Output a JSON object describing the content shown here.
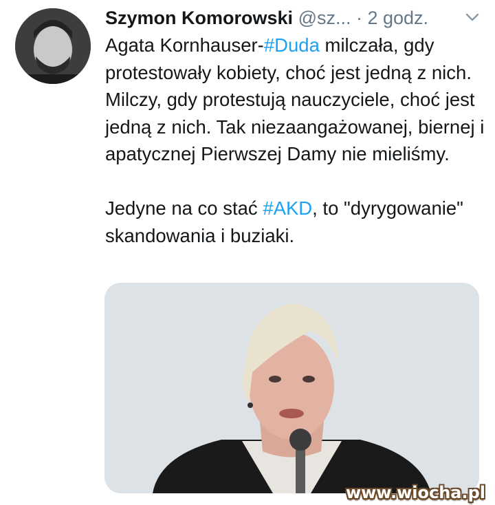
{
  "tweet": {
    "author_name": "Szymon Komorowski",
    "handle": "@sz...",
    "separator": " · ",
    "time": "2 godz.",
    "paragraph1": [
      {
        "text": "Agata Kornhauser-",
        "tag": false
      },
      {
        "text": "#Duda",
        "tag": true
      },
      {
        "text": " milczała, gdy protestowały kobiety, choć jest jedną z nich. Milczy, gdy protestują nauczyciele, choć jest jedną z nich. Tak niezaangażowanej, biernej i apatycznej Pierwszej Damy nie mieliśmy.",
        "tag": false
      }
    ],
    "paragraph2": [
      {
        "text": "Jedyne na co stać ",
        "tag": false
      },
      {
        "text": "#AKD",
        "tag": true
      },
      {
        "text": ", to \"dyrygowanie\" skandowania i buziaki.",
        "tag": false
      }
    ]
  },
  "icons": {
    "avatar": "avatar",
    "menu": "chevron-down-icon"
  },
  "watermark": "www.wiocha.pl",
  "colors": {
    "hashtag": "#1da1f2",
    "text": "#14171a",
    "muted": "#657786"
  }
}
